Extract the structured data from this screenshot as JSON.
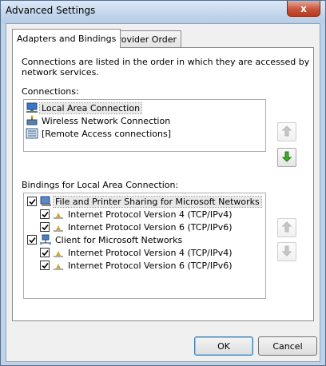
{
  "window": {
    "title": "Advanced Settings",
    "close_glyph": "x"
  },
  "tabs": [
    {
      "label": "Adapters and Bindings",
      "active": true
    },
    {
      "label": "Provider Order",
      "active": false
    }
  ],
  "intro_text_line1": "Connections are listed in the order in which they are accessed by",
  "intro_text_line2": "network services.",
  "connections": {
    "label": "Connections:",
    "items": [
      {
        "label": "Local Area Connection",
        "icon": "network-connection-icon",
        "selected": true
      },
      {
        "label": "Wireless Network Connection",
        "icon": "wireless-connection-icon",
        "selected": false
      },
      {
        "label": "[Remote Access connections]",
        "icon": "remote-access-icon",
        "selected": false
      }
    ],
    "up_enabled": false,
    "down_enabled": true
  },
  "bindings": {
    "label": "Bindings for Local Area Connection:",
    "items": [
      {
        "label": "File and Printer Sharing for Microsoft Networks",
        "level": 0,
        "checked": true,
        "icon": "file-printer-sharing-icon",
        "selected": true
      },
      {
        "label": "Internet Protocol Version 4 (TCP/IPv4)",
        "level": 1,
        "checked": true,
        "icon": "protocol-icon",
        "selected": false
      },
      {
        "label": "Internet Protocol Version 6 (TCP/IPv6)",
        "level": 1,
        "checked": true,
        "icon": "protocol-icon",
        "selected": false
      },
      {
        "label": "Client for Microsoft Networks",
        "level": 0,
        "checked": true,
        "icon": "network-client-icon",
        "selected": false
      },
      {
        "label": "Internet Protocol Version 4 (TCP/IPv4)",
        "level": 1,
        "checked": true,
        "icon": "protocol-icon",
        "selected": false
      },
      {
        "label": "Internet Protocol Version 6 (TCP/IPv6)",
        "level": 1,
        "checked": true,
        "icon": "protocol-icon",
        "selected": false
      }
    ],
    "up_enabled": false,
    "down_enabled": false
  },
  "footer": {
    "ok_label": "OK",
    "cancel_label": "Cancel"
  }
}
